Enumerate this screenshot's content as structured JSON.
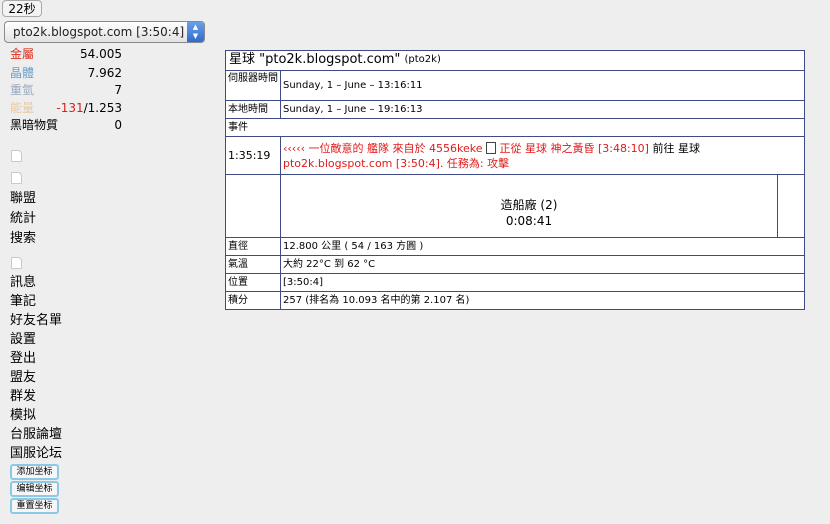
{
  "timer": "22秒",
  "planet_select": "pto2k.blogspot.com [3:50:4]",
  "resources": [
    {
      "name": "金屬",
      "value": "54.005",
      "name_color": "#e0301e",
      "value_color": "#000000"
    },
    {
      "name": "晶體",
      "value": "7.962",
      "name_color": "#6a9ec9",
      "value_color": "#000000"
    },
    {
      "name": "重氫",
      "value": "7",
      "name_color": "#96a8bf",
      "value_color": "#000000"
    },
    {
      "name": "能量",
      "value_neg": "-131",
      "value_rest": "/1.253",
      "name_color": "#e8c9a0",
      "value_color": "#e01a1a"
    },
    {
      "name": "黑暗物質",
      "value": "0",
      "name_color": "#000000",
      "value_color": "#000000"
    }
  ],
  "menu_group_1": [
    "聯盟",
    "統計",
    "搜索"
  ],
  "menu_group_2": [
    "訊息",
    "筆記",
    "好友名單",
    "設置",
    "登出",
    "盟友",
    "群发",
    "模拟",
    "台服論壇",
    "国服论坛"
  ],
  "coord_buttons": [
    "添加坐标",
    "编辑坐标",
    "重置坐标"
  ],
  "panel": {
    "title_prefix": "星球 \"pto2k.blogspot.com\"",
    "title_code": "(pto2k)",
    "server_time_label": "伺服器時間",
    "server_time": "Sunday, 1 – June – 13:16:11",
    "local_time_label": "本地時間",
    "local_time": "Sunday, 1 – June – 19:16:13",
    "events_label": "事件",
    "event": {
      "time": "1:35:19",
      "arrows": "‹‹‹‹‹",
      "text_1": "一位敵意的 艦隊 來自於 4556keke",
      "text_2": "正從 星球 神之黃昏 [3:48:10]",
      "text_3": "前往 星球",
      "text_4": "pto2k.blogspot.com [3:50:4]. 任務為: 攻擊"
    },
    "build": {
      "name": "造船廠 (2)",
      "time": "0:08:41"
    },
    "diameter_label": "直徑",
    "diameter": "12.800 公里 ( 54 / 163 方圓 )",
    "temp_label": "氣溫",
    "temp": "大約 22°C 到 62 °C",
    "pos_label": "位置",
    "pos": "[3:50:4]",
    "score_label": "積分",
    "score": "257 (排名為 10.093 名中的第 2.107 名)"
  }
}
